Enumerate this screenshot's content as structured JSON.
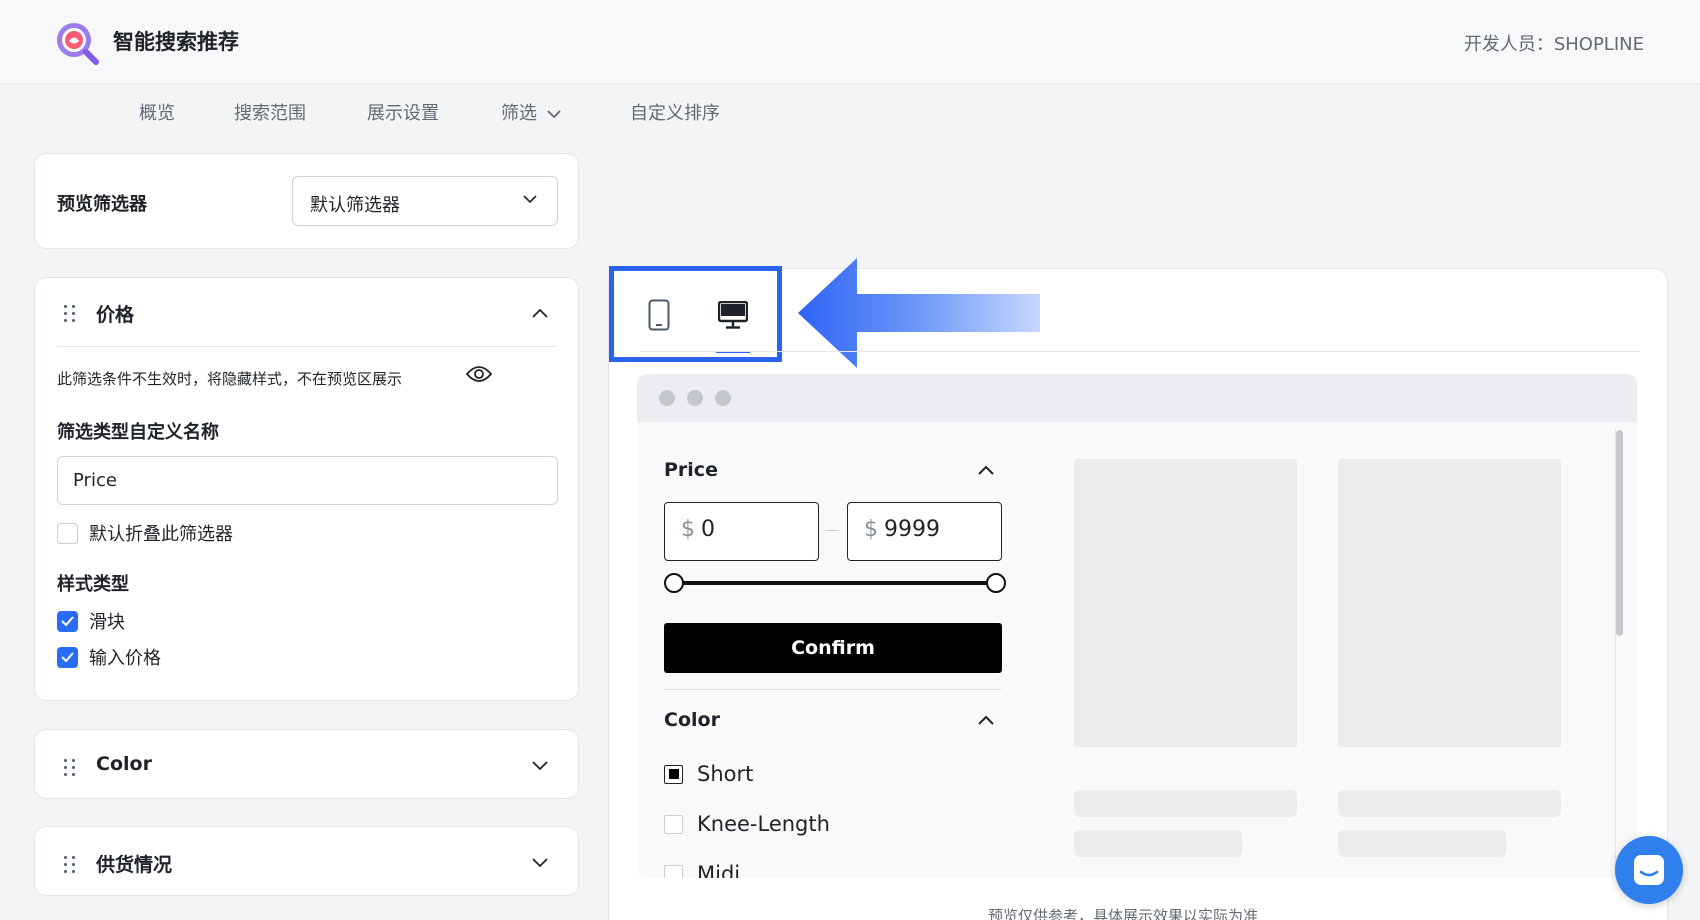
{
  "header": {
    "app_title": "智能搜索推荐",
    "developer": "开发人员：SHOPLINE"
  },
  "nav": {
    "items": [
      "概览",
      "搜索范围",
      "展示设置",
      "筛选",
      "自定义排序"
    ]
  },
  "preview_filter": {
    "label": "预览筛选器",
    "selected": "默认筛选器"
  },
  "price_panel": {
    "title": "价格",
    "hint": "此筛选条件不生效时，将隐藏样式，不在预览区展示",
    "custom_name_label": "筛选类型自定义名称",
    "custom_name_value": "Price",
    "collapse_label": "默认折叠此筛选器",
    "collapse_checked": false,
    "style_type_label": "样式类型",
    "style_options": [
      {
        "label": "滑块",
        "checked": true
      },
      {
        "label": "输入价格",
        "checked": true
      }
    ]
  },
  "collapsed_panels": [
    {
      "title": "Color"
    },
    {
      "title": "供货情况"
    }
  ],
  "device_tabs": {
    "items": [
      "mobile-icon",
      "desktop-icon"
    ],
    "active": "desktop-icon",
    "highlight_color": "#2a62f2"
  },
  "storefront_preview": {
    "price_filter": {
      "title": "Price",
      "currency": "$",
      "min": "0",
      "max": "9999",
      "confirm_label": "Confirm"
    },
    "color_filter": {
      "title": "Color",
      "options": [
        {
          "label": "Short",
          "checked": true
        },
        {
          "label": "Knee-Length",
          "checked": false
        },
        {
          "label": "Midi",
          "checked": false
        }
      ]
    },
    "footer_note": "预览仅供参考，具体展示效果以实际为准"
  },
  "colors": {
    "accent": "#2a6cf6",
    "confirm_button": "#000000",
    "chat_button": "#2f80ec"
  }
}
